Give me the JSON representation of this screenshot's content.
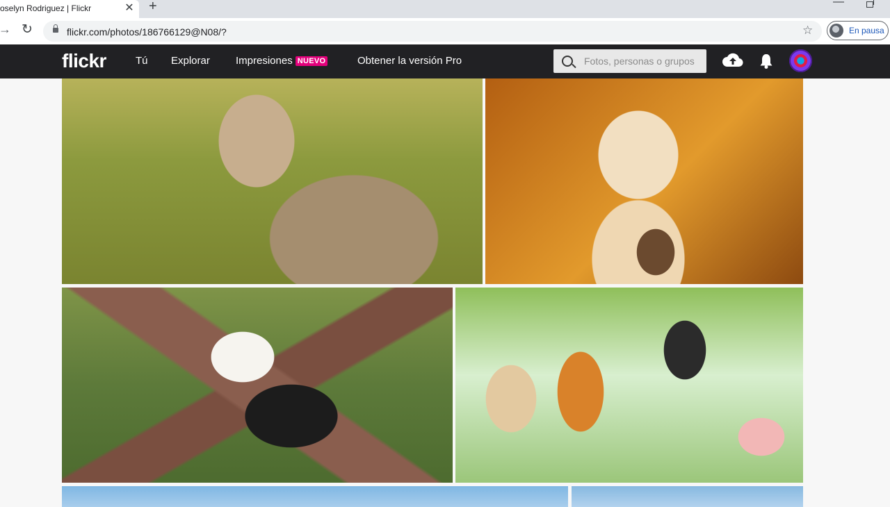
{
  "browser": {
    "tab_title": "oselyn Rodriguez | Flickr",
    "tab_close_glyph": "✕",
    "new_tab_glyph": "+",
    "url": "flickr.com/photos/186766129@N08/?",
    "profile_status": "En pausa",
    "icons": [
      "forward-icon",
      "reload-icon",
      "lock-icon",
      "star-icon",
      "minimize-icon",
      "restore-icon"
    ]
  },
  "flickr": {
    "logo": "flickr",
    "nav": {
      "you": "Tú",
      "explore": "Explorar",
      "prints": "Impresiones",
      "prints_badge": "NUEVO",
      "get_pro": "Obtener la versión Pro"
    },
    "search": {
      "placeholder": "Fotos, personas o grupos"
    },
    "icons": [
      "search-icon",
      "upload-cloud-icon",
      "notifications-bell-icon",
      "user-avatar"
    ],
    "colors": {
      "header_bg": "#212124",
      "badge_bg": "#e4007c"
    }
  },
  "photos": [
    {
      "subject": "puma-photo"
    },
    {
      "subject": "golden-retriever-puppy-photo"
    },
    {
      "subject": "panda-photo"
    },
    {
      "subject": "animals-collage-photo"
    },
    {
      "subject": "bottom-left-photo-partial"
    },
    {
      "subject": "bottom-right-photo-partial"
    }
  ]
}
